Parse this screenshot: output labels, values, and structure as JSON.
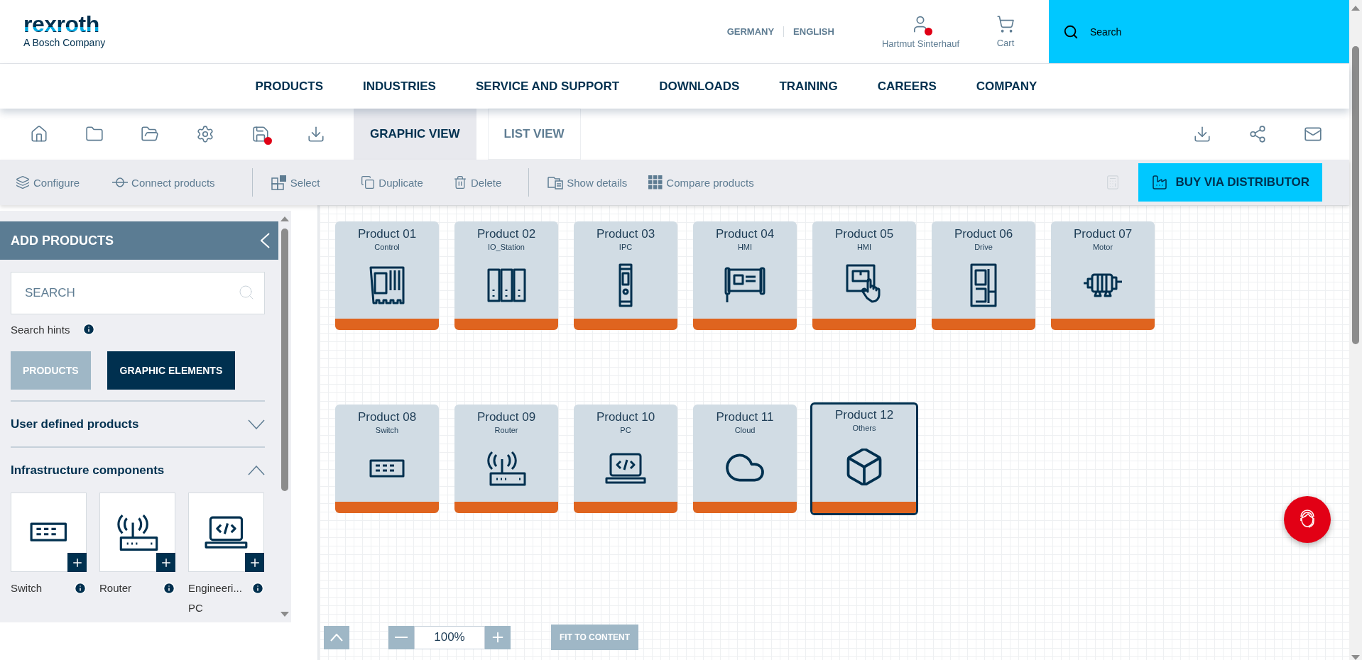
{
  "header": {
    "logo": {
      "wordmark": "rexroth",
      "tagline": "A Bosch Company"
    },
    "country": "GERMANY",
    "language": "ENGLISH",
    "user": {
      "name": "Hartmut Sinterhauf",
      "notification": true
    },
    "cart": {
      "label": "Cart"
    },
    "search": {
      "placeholder": "Search"
    }
  },
  "nav": [
    "PRODUCTS",
    "INDUSTRIES",
    "SERVICE AND SUPPORT",
    "DOWNLOADS",
    "TRAINING",
    "CAREERS",
    "COMPANY"
  ],
  "toolbar": {
    "unsaved_changes": true,
    "view_tabs": [
      {
        "label": "GRAPHIC VIEW",
        "selected": true
      },
      {
        "label": "LIST VIEW",
        "selected": false
      }
    ]
  },
  "actions": [
    {
      "kind": "configure",
      "label": "Configure"
    },
    {
      "kind": "connect",
      "label": "Connect products"
    },
    {
      "kind": "divider"
    },
    {
      "kind": "select",
      "label": "Select"
    },
    {
      "kind": "duplicate",
      "label": "Duplicate"
    },
    {
      "kind": "delete",
      "label": "Delete"
    },
    {
      "kind": "divider"
    },
    {
      "kind": "details",
      "label": "Show details"
    },
    {
      "kind": "compare",
      "label": "Compare products"
    }
  ],
  "buy_button": "BUY VIA DISTRIBUTOR",
  "calculator_disabled": true,
  "sidebar": {
    "title": "ADD PRODUCTS",
    "search": {
      "placeholder": "SEARCH"
    },
    "hints": "Search hints",
    "tabs": [
      {
        "label": "PRODUCTS",
        "selected": false
      },
      {
        "label": "GRAPHIC ELEMENTS",
        "selected": true
      }
    ],
    "sections": [
      {
        "title": "User defined products",
        "expanded": false
      },
      {
        "title": "Infrastructure components",
        "expanded": true,
        "items": [
          {
            "kind": "switch",
            "label_lines": [
              "Switch"
            ]
          },
          {
            "kind": "router",
            "label_lines": [
              "Router"
            ]
          },
          {
            "kind": "pc",
            "label_lines": [
              "Engineeri...",
              "PC"
            ]
          }
        ]
      }
    ]
  },
  "canvas": {
    "products": [
      {
        "name": "Product 01",
        "type": "Control",
        "kind": "control",
        "selected": false
      },
      {
        "name": "Product 02",
        "type": "IO_Station",
        "kind": "io",
        "selected": false
      },
      {
        "name": "Product 03",
        "type": "IPC",
        "kind": "ipc",
        "selected": false
      },
      {
        "name": "Product 04",
        "type": "HMI",
        "kind": "panel",
        "selected": false
      },
      {
        "name": "Product 05",
        "type": "HMI",
        "kind": "touch",
        "selected": false
      },
      {
        "name": "Product 06",
        "type": "Drive",
        "kind": "drive",
        "selected": false
      },
      {
        "name": "Product 07",
        "type": "Motor",
        "kind": "motor",
        "selected": false
      },
      {
        "name": "Product 08",
        "type": "Switch",
        "kind": "switch",
        "selected": false
      },
      {
        "name": "Product 09",
        "type": "Router",
        "kind": "router",
        "selected": false
      },
      {
        "name": "Product 10",
        "type": "PC",
        "kind": "pc",
        "selected": false
      },
      {
        "name": "Product 11",
        "type": "Cloud",
        "kind": "cloud",
        "selected": false
      },
      {
        "name": "Product 12",
        "type": "Others",
        "kind": "box",
        "selected": true
      }
    ],
    "zoom": "100%",
    "fit_button": "FIT TO CONTENT"
  }
}
